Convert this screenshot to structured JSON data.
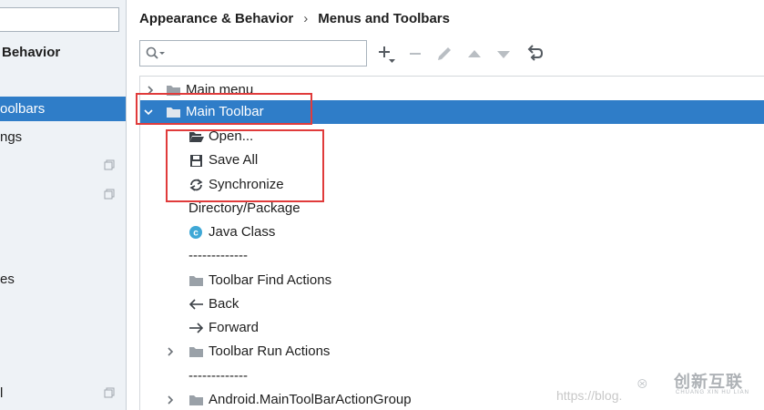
{
  "sidebar": {
    "search_value": "",
    "items": [
      {
        "label": "Behavior",
        "bold": true
      },
      {
        "label": "oolbars",
        "selected": true
      },
      {
        "label": "ngs"
      },
      {
        "label": "es"
      },
      {
        "label": "l"
      }
    ]
  },
  "breadcrumb": {
    "parent": "Appearance & Behavior",
    "separator": "›",
    "current": "Menus and Toolbars"
  },
  "toolbar": {
    "search_placeholder": "",
    "buttons": [
      "add-icon",
      "remove-icon",
      "edit-icon",
      "move-up-icon",
      "move-down-icon",
      "restore-icon"
    ]
  },
  "tree": {
    "rows": [
      {
        "label": "Main menu",
        "icon": "folder-icon",
        "arrow": "collapsed",
        "level": 0
      },
      {
        "label": "Main Toolbar",
        "icon": "folder-icon",
        "arrow": "expanded",
        "level": 0,
        "selected": true
      },
      {
        "label": "Open...",
        "icon": "open-folder-icon",
        "level": 1
      },
      {
        "label": "Save All",
        "icon": "save-icon",
        "level": 1
      },
      {
        "label": "Synchronize",
        "icon": "sync-icon",
        "level": 1
      },
      {
        "label": "Directory/Package",
        "icon": "",
        "level": 1
      },
      {
        "label": "Java Class",
        "icon": "java-class-icon",
        "level": 1
      },
      {
        "label": "-------------",
        "icon": "",
        "level": 1
      },
      {
        "label": "Toolbar Find Actions",
        "icon": "folder-icon",
        "level": 1
      },
      {
        "label": "Back",
        "icon": "arrow-left-icon",
        "level": 1
      },
      {
        "label": "Forward",
        "icon": "arrow-right-icon",
        "level": 1
      },
      {
        "label": "Toolbar Run Actions",
        "icon": "folder-icon",
        "arrow": "collapsed",
        "level": 1
      },
      {
        "label": "-------------",
        "icon": "",
        "level": 1
      },
      {
        "label": "Android.MainToolBarActionGroup",
        "icon": "folder-icon",
        "arrow": "collapsed",
        "level": 1
      }
    ]
  },
  "watermark": {
    "url": "https://blog.",
    "logo_text": "创新互联",
    "logo_sub": "CHUANG XIN HU LIAN"
  },
  "colors": {
    "selection": "#2f7dc8",
    "highlight_box": "#e03b3b",
    "sidebar_bg": "#eef2f6"
  }
}
